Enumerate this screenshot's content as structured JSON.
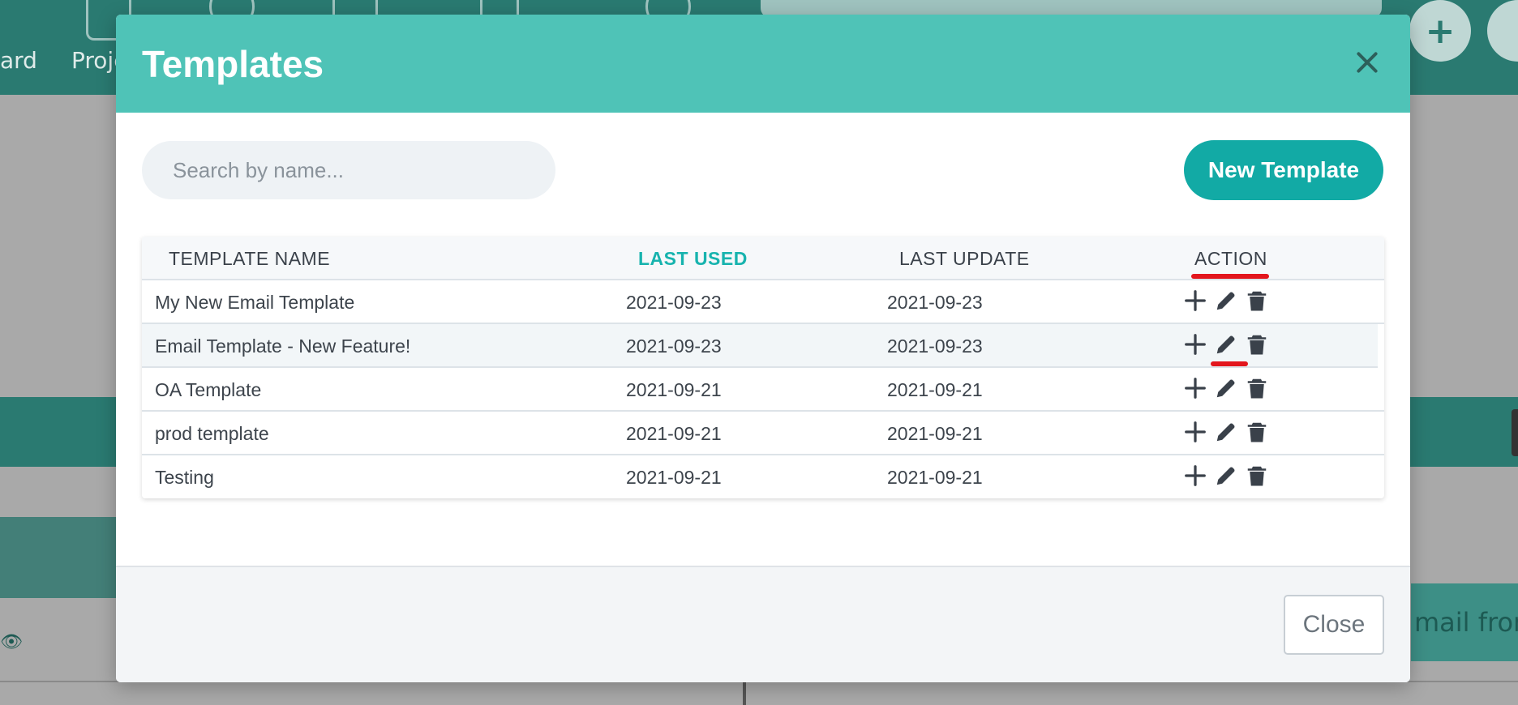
{
  "background": {
    "nav": [
      {
        "label": "ard"
      },
      {
        "label": "Proje"
      }
    ],
    "add_glyph": "+",
    "email_chip": "mail from",
    "eye_glyph": "👁"
  },
  "modal": {
    "title": "Templates",
    "close_glyph": "×",
    "search": {
      "placeholder": "Search by name...",
      "value": ""
    },
    "new_button": "New Template",
    "close_button": "Close",
    "table": {
      "headers": {
        "name": "TEMPLATE NAME",
        "last_used": "LAST USED",
        "last_update": "LAST UPDATE",
        "action": "ACTION"
      },
      "rows": [
        {
          "name": "My New Email Template",
          "last_used": "2021-09-23",
          "last_update": "2021-09-23"
        },
        {
          "name": "Email Template - New Feature!",
          "last_used": "2021-09-23",
          "last_update": "2021-09-23"
        },
        {
          "name": "OA Template",
          "last_used": "2021-09-21",
          "last_update": "2021-09-21"
        },
        {
          "name": "prod template",
          "last_used": "2021-09-21",
          "last_update": "2021-09-21"
        },
        {
          "name": "Testing",
          "last_used": "2021-09-21",
          "last_update": "2021-09-21"
        }
      ],
      "action_icons": [
        "plus-icon",
        "pencil-icon",
        "trash-icon"
      ]
    }
  },
  "colors": {
    "header_bg": "#4fc3b7",
    "accent": "#12aaa5",
    "active_header": "#17b3ae",
    "annotation_red": "#e3161d",
    "icon": "#3a414a"
  }
}
